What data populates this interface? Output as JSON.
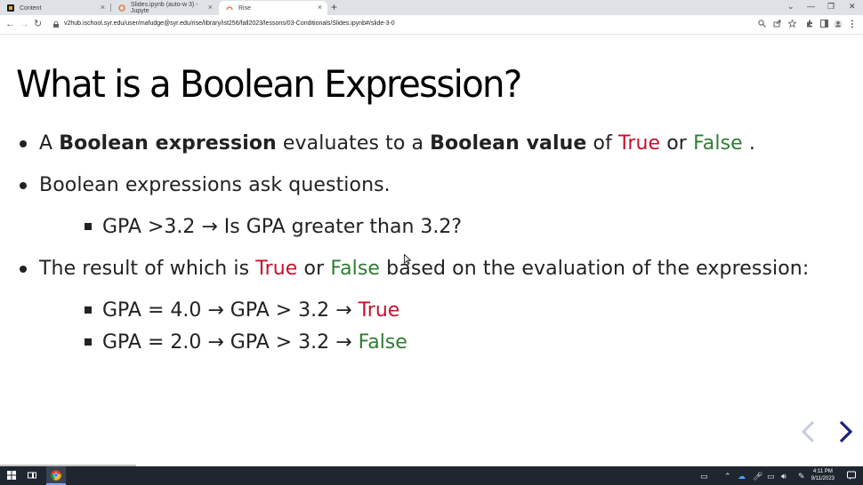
{
  "browser": {
    "tabs": [
      {
        "label": "Content",
        "active": false
      },
      {
        "label": "Slides.ipynb (auto-w 3) - Jupyte",
        "active": false
      },
      {
        "label": "Rise",
        "active": true
      }
    ],
    "new_tab_symbol": "+",
    "close_symbol": "×",
    "window_controls": {
      "dropdown": "⌄",
      "minimize": "—",
      "restore": "❐",
      "close": "✕"
    },
    "url": "v2hub.ischool.syr.edu/user/mafudge@syr.edu/rise/library/ist256/fall2023/lessons/03-Conditionals/Slides.ipynb#/slide-3-0",
    "nav": {
      "back": "←",
      "forward": "→",
      "reload": "↻"
    },
    "toolbar_icons": [
      "zoom-icon",
      "share-icon",
      "star-icon",
      "extensions-icon",
      "sidebar-icon",
      "profile-icon",
      "menu-icon"
    ]
  },
  "slide": {
    "title": "What is a Boolean Expression?",
    "bullet1": {
      "p1": "A ",
      "b1": "Boolean expression",
      "p2": " evaluates to a ",
      "b2": "Boolean value",
      "p3": " of ",
      "true": "True",
      "or": " or ",
      "false": "False",
      "end": " ."
    },
    "bullet2": "Boolean expressions ask questions.",
    "sub1": "GPA >3.2 → Is GPA greater than 3.2?",
    "bullet3": {
      "p1": "The result of which is ",
      "true": "True",
      "or": " or ",
      "false": "False",
      "p2": " based on the evaluation of the expression:"
    },
    "sub2": {
      "expr": "GPA = 4.0 → GPA > 3.2 → ",
      "result": "True"
    },
    "sub3": {
      "expr": "GPA = 2.0 → GPA > 3.2 → ",
      "result": "False"
    }
  },
  "taskbar": {
    "time": "4:11 PM",
    "date": "9/11/2023"
  },
  "colors": {
    "true": "#c8102e",
    "false": "#2e7d32",
    "nav_arrow_active": "#1a237e",
    "nav_arrow_inactive": "#c7cbe0"
  }
}
